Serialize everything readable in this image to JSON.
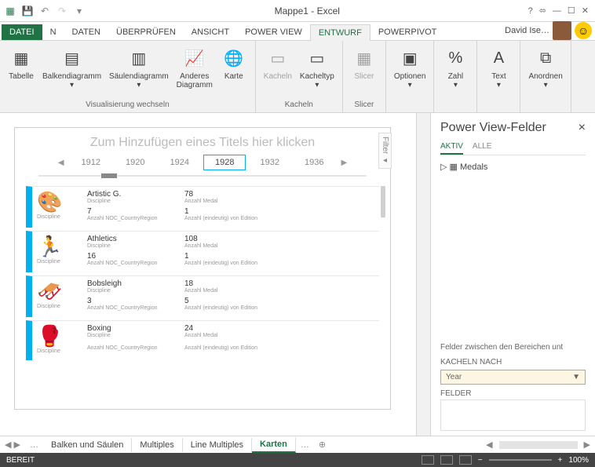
{
  "title": "Mappe1 - Excel",
  "help_icon": "?",
  "tabs": {
    "file": "DATEI",
    "n": "N",
    "data": "DATEN",
    "review": "ÜBERPRÜFEN",
    "view": "ANSICHT",
    "powerview": "POWER VIEW",
    "design": "ENTWURF",
    "powerpivot": "POWERPIVOT"
  },
  "user": "David Ise…",
  "ribbon": {
    "vis": {
      "title": "Visualisierung wechseln",
      "tabelle": "Tabelle",
      "balken": "Balkendiagramm",
      "saulen": "Säulendiagramm",
      "anderes": "Anderes\nDiagramm",
      "karte": "Karte"
    },
    "kacheln": {
      "title": "Kacheln",
      "kacheln": "Kacheln",
      "typ": "Kacheltyp"
    },
    "slicer": {
      "title": "Slicer",
      "slicer": "Slicer"
    },
    "opt": "Optionen",
    "zahl": "Zahl",
    "text": "Text",
    "anordnen": "Anordnen"
  },
  "canvas": {
    "title_placeholder": "Zum Hinzufügen eines Titels hier klicken",
    "years": [
      "1912",
      "1920",
      "1924",
      "1928",
      "1932",
      "1936"
    ],
    "selected_year": "1928",
    "filter": "Filter",
    "labels": {
      "discipline": "Discipline",
      "anzahl_medal": "Anzahl Medal",
      "anzahl_noc": "Anzahl NOC_CountryRegion",
      "anzahl_edition": "Anzahl (eindeutig) von Edition"
    },
    "cards": [
      {
        "name": "Artistic G.",
        "medals": "78",
        "noc": "7",
        "ed": "1"
      },
      {
        "name": "Athletics",
        "medals": "108",
        "noc": "16",
        "ed": "1"
      },
      {
        "name": "Bobsleigh",
        "medals": "18",
        "noc": "3",
        "ed": "5"
      },
      {
        "name": "Boxing",
        "medals": "24",
        "noc": "",
        "ed": ""
      }
    ]
  },
  "fields": {
    "title": "Power View-Felder",
    "tabs": {
      "aktiv": "AKTIV",
      "alle": "ALLE"
    },
    "tree": "Medals",
    "areas_caption": "Felder zwischen den Bereichen unt",
    "kacheln_nach": "KACHELN NACH",
    "kacheln_value": "Year",
    "felder": "FELDER"
  },
  "sheets": {
    "nav": "…",
    "s1": "Balken und Säulen",
    "s2": "Multiples",
    "s3": "Line Multiples",
    "s4": "Karten",
    "more": "…"
  },
  "status": {
    "ready": "BEREIT",
    "zoom": "100%"
  }
}
